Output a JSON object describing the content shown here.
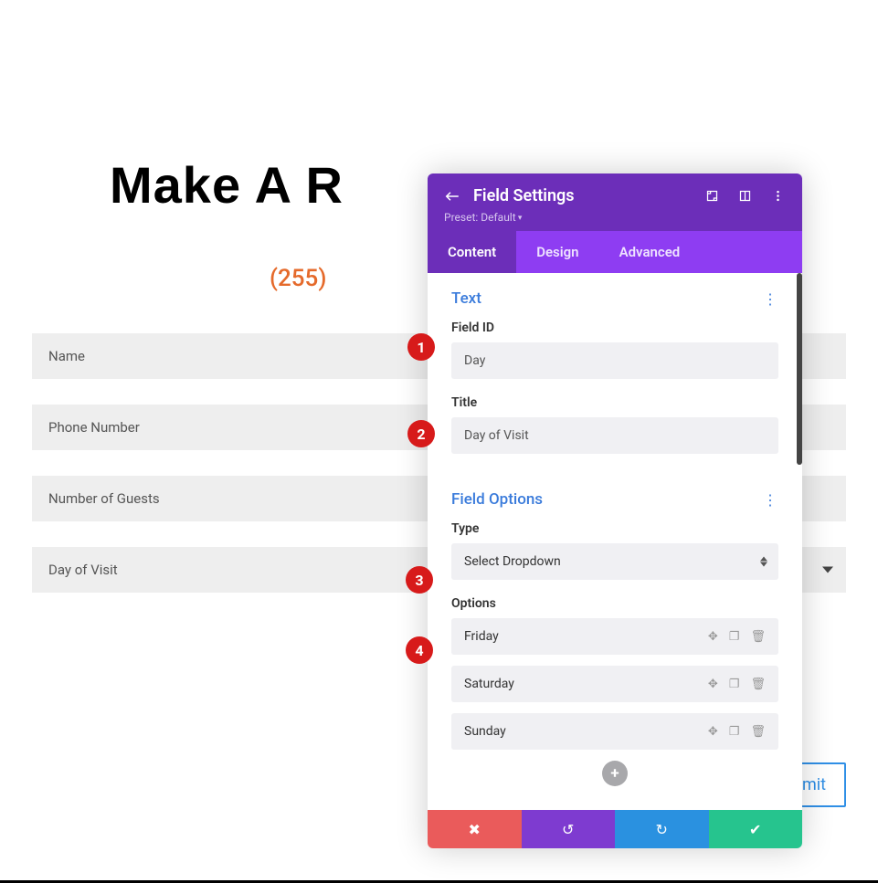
{
  "page": {
    "title": "Make A R",
    "subtitle": "(255)",
    "form_fields": [
      "Name",
      "Phone Number",
      "Number of Guests",
      "Day of Visit"
    ],
    "submit_label": "omit"
  },
  "panel": {
    "header": {
      "title": "Field Settings",
      "preset": "Preset: Default"
    },
    "tabs": [
      "Content",
      "Design",
      "Advanced"
    ],
    "text_section": {
      "title": "Text",
      "field_id_label": "Field ID",
      "field_id_value": "Day",
      "title_label": "Title",
      "title_value": "Day of Visit"
    },
    "options_section": {
      "title": "Field Options",
      "type_label": "Type",
      "type_value": "Select Dropdown",
      "options_label": "Options",
      "options": [
        "Friday",
        "Saturday",
        "Sunday"
      ]
    }
  },
  "annotations": [
    "1",
    "2",
    "3",
    "4"
  ]
}
